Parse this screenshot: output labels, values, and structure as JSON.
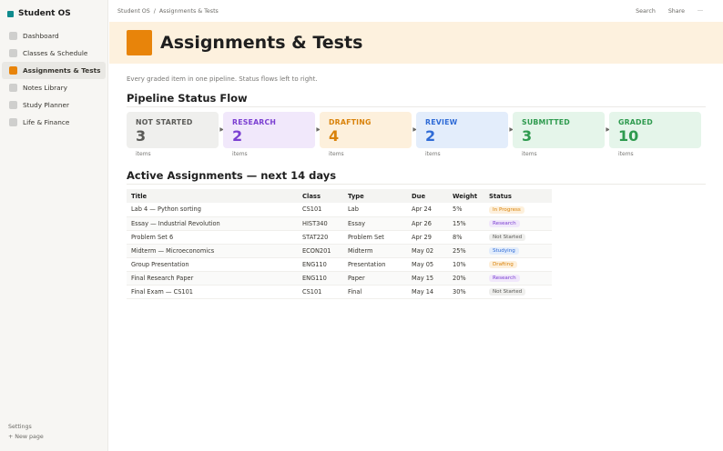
{
  "sidebar": {
    "workspace": "Student OS",
    "items": [
      {
        "label": "Dashboard"
      },
      {
        "label": "Classes & Schedule"
      },
      {
        "label": "Assignments & Tests"
      },
      {
        "label": "Notes Library"
      },
      {
        "label": "Study Planner"
      },
      {
        "label": "Life & Finance"
      }
    ],
    "active_index": 2,
    "settings": "Settings",
    "new_page": "+  New page"
  },
  "topbar": {
    "breadcrumb_root": "Student OS",
    "breadcrumb_sep": "/",
    "breadcrumb_current": "Assignments & Tests",
    "search": "Search",
    "share": "Share",
    "more": "···"
  },
  "page": {
    "title": "Assignments & Tests",
    "description": "Every graded item in one pipeline. Status flows left to right.",
    "pipeline_heading": "Pipeline Status Flow",
    "active_heading": "Active Assignments — next 14 days"
  },
  "pipeline": [
    {
      "label": "NOT STARTED",
      "count": "3",
      "sub": "items",
      "bg": "#efefed",
      "fg": "#5a5a57"
    },
    {
      "label": "RESEARCH",
      "count": "2",
      "sub": "items",
      "bg": "#f1e8fb",
      "fg": "#7b3fd1"
    },
    {
      "label": "DRAFTING",
      "count": "4",
      "sub": "items",
      "bg": "#fdf0dc",
      "fg": "#d9820a"
    },
    {
      "label": "REVIEW",
      "count": "2",
      "sub": "items",
      "bg": "#e3edfb",
      "fg": "#2f6bd6"
    },
    {
      "label": "SUBMITTED",
      "count": "3",
      "sub": "items",
      "bg": "#e5f5ea",
      "fg": "#2e9a4e"
    },
    {
      "label": "GRADED",
      "count": "10",
      "sub": "items",
      "bg": "#e5f5ea",
      "fg": "#2e9a4e"
    }
  ],
  "table": {
    "headers": [
      "Title",
      "Class",
      "Type",
      "Due",
      "Weight",
      "Status"
    ],
    "rows": [
      {
        "title": "Lab 4 — Python sorting",
        "class": "CS101",
        "type": "Lab",
        "due": "Apr 24",
        "weight": "5%",
        "status": "In Progress",
        "status_bg": "#fdf0dc",
        "status_fg": "#d9820a"
      },
      {
        "title": "Essay — Industrial Revolution",
        "class": "HIST340",
        "type": "Essay",
        "due": "Apr 26",
        "weight": "15%",
        "status": "Research",
        "status_bg": "#f1e8fb",
        "status_fg": "#7b3fd1"
      },
      {
        "title": "Problem Set 6",
        "class": "STAT220",
        "type": "Problem Set",
        "due": "Apr 29",
        "weight": "8%",
        "status": "Not Started",
        "status_bg": "#efefed",
        "status_fg": "#5a5a57"
      },
      {
        "title": "Midterm — Microeconomics",
        "class": "ECON201",
        "type": "Midterm",
        "due": "May 02",
        "weight": "25%",
        "status": "Studying",
        "status_bg": "#e3edfb",
        "status_fg": "#2f6bd6"
      },
      {
        "title": "Group Presentation",
        "class": "ENG110",
        "type": "Presentation",
        "due": "May 05",
        "weight": "10%",
        "status": "Drafting",
        "status_bg": "#fdf0dc",
        "status_fg": "#d9820a"
      },
      {
        "title": "Final Research Paper",
        "class": "ENG110",
        "type": "Paper",
        "due": "May 15",
        "weight": "20%",
        "status": "Research",
        "status_bg": "#f1e8fb",
        "status_fg": "#7b3fd1"
      },
      {
        "title": "Final Exam — CS101",
        "class": "CS101",
        "type": "Final",
        "due": "May 14",
        "weight": "30%",
        "status": "Not Started",
        "status_bg": "#efefed",
        "status_fg": "#5a5a57"
      }
    ]
  }
}
